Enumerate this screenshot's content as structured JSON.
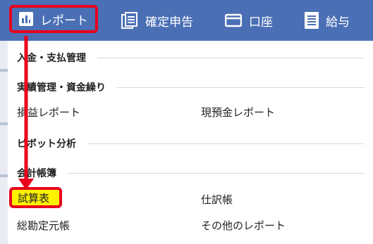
{
  "nav": {
    "report_label": "レポート",
    "tax_label": "確定申告",
    "account_label": "口座",
    "salary_label": "給与"
  },
  "menu": {
    "sections": {
      "deposits": "入金・支払管理",
      "performance": "実績管理・資金繰り",
      "pivot": "ピボット分析",
      "ledger": "会計帳簿"
    },
    "items": {
      "profit_loss": "損益レポート",
      "cash_deposit": "現預金レポート",
      "trial_balance": "試算表",
      "journal": "仕訳帳",
      "general_ledger": "総勘定元帳",
      "other_reports": "その他のレポート"
    }
  },
  "colors": {
    "nav_bg": "#4a6fb5",
    "highlight_border": "#e8001c",
    "highlight_fill": "#fff200"
  },
  "icons": [
    "bar-chart-icon",
    "document-stack-icon",
    "card-icon",
    "payslip-icon",
    "arrow-down-icon"
  ]
}
